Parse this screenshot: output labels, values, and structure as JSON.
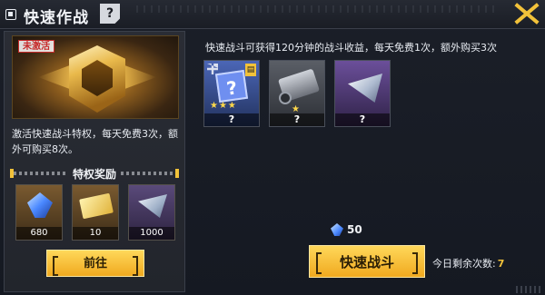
{
  "header": {
    "title": "快速作战",
    "help_label": "?"
  },
  "left_panel": {
    "inactive_tag": "未激活",
    "description": "激活快速战斗特权，每天免费3次，额外可购买8次。",
    "privilege_title": "特权奖励",
    "rewards": [
      {
        "icon": "blue-crystal-icon",
        "count": "680"
      },
      {
        "icon": "gold-ticket-icon",
        "count": "10"
      },
      {
        "icon": "silver-shard-icon",
        "count": "1000"
      }
    ],
    "goto_label": "前往"
  },
  "right_panel": {
    "description": "快速战斗可获得120分钟的战斗收益，每天免费1次，额外购买3次",
    "rewards": [
      {
        "icon": "mystery-box-icon",
        "count": "?",
        "stars": "★★★"
      },
      {
        "icon": "mech-part-icon",
        "count": "?",
        "stars": "★"
      },
      {
        "icon": "silver-shard-icon",
        "count": "?"
      }
    ],
    "cost_value": "50",
    "quick_battle_label": "快速战斗",
    "remaining_label": "今日剩余次数:",
    "remaining_value": "7"
  },
  "colors": {
    "accent": "#f2c23a",
    "button": "#f0a91f",
    "background": "#151922"
  }
}
